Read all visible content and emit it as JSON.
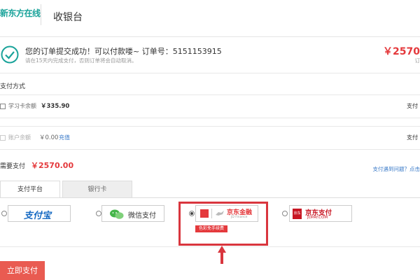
{
  "header": {
    "logo_text": "新东方在线",
    "page_title": "收银台"
  },
  "order": {
    "message": "您的订单提交成功！可以付款喽~ 订单号：5151153915",
    "sub_message": "请在15天内完成支付，否则订单将会自动取消。",
    "amount": "￥2570",
    "extra": "订"
  },
  "payment_method": {
    "title": "支付方式",
    "study_card": {
      "label": "学习卡余额",
      "value": "￥335.90",
      "right_label": "支付"
    },
    "account": {
      "label": "账户余额",
      "value": "￥0.00",
      "recharge_label": "充值",
      "right_label": "支付"
    }
  },
  "need_pay": {
    "label": "需要支付",
    "amount": "￥2570.00",
    "problem_link": "支付遇到问题？点击"
  },
  "tabs": {
    "platform": "支付平台",
    "bank": "银行卡"
  },
  "pay_options": {
    "alipay": "支付宝",
    "wechat": "微信支付",
    "jd_finance": "京东金融",
    "jd_finance_sub": "JD Finance",
    "jd_finance_promo": "色彩免手续费",
    "jdpay": "京东支付",
    "jdpay_sub": "JDPAY.COM",
    "jdpay_badge": "京东"
  },
  "pay_button": "立即支付",
  "colors": {
    "accent_red": "#e4393c",
    "brand_teal": "#1aa39a",
    "link_blue": "#3a7ac8",
    "pay_button": "#e95b51"
  }
}
